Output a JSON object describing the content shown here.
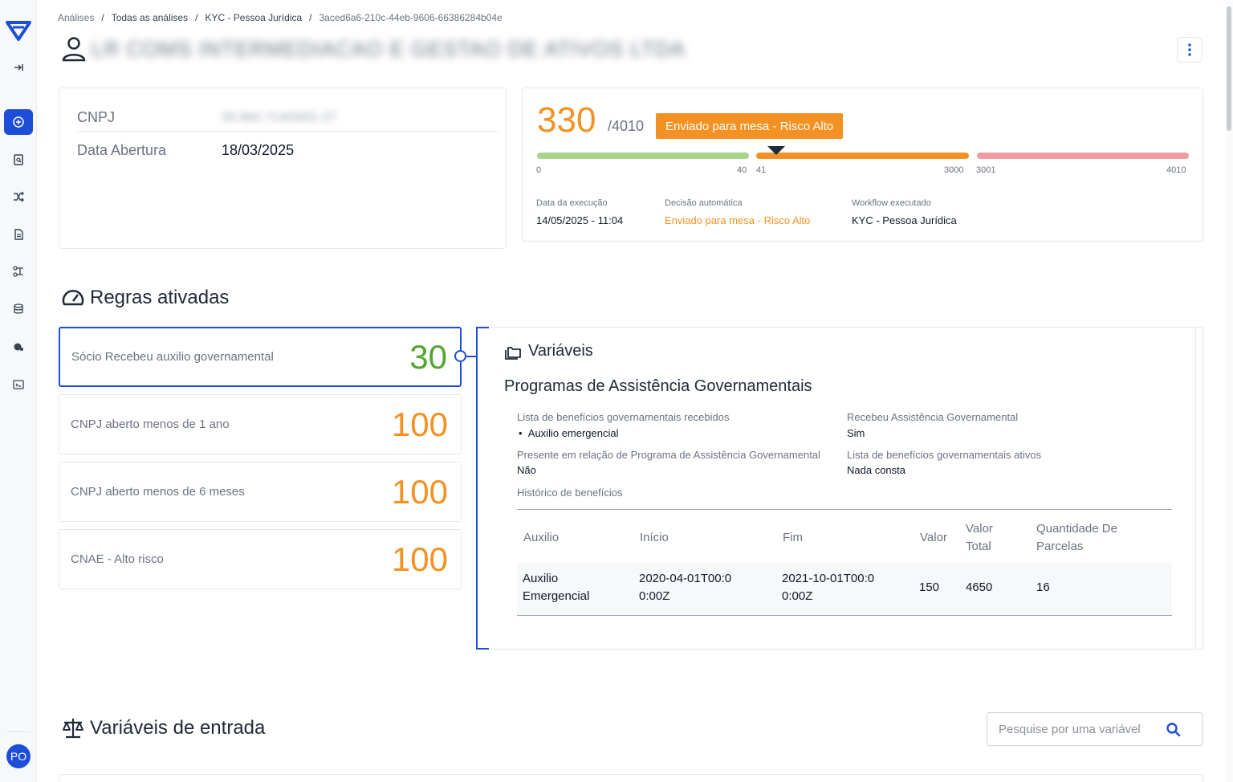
{
  "breadcrumb": [
    "Análises",
    "Todas as análises",
    "KYC - Pessoa Jurídica",
    "3aced6a6-210c-44eb-9606-66386284b04e"
  ],
  "header": {
    "company_name": "LR COMS INTERMEDIACAO E GESTAO DE ATIVOS LTDA"
  },
  "sidebar": {
    "icons": [
      "logo-icon",
      "expand-icon",
      "add-circle-icon",
      "search-document-icon",
      "shuffle-icon",
      "document-icon",
      "flow-icon",
      "database-icon",
      "analytics-icon",
      "terminal-icon"
    ],
    "avatar_initials": "PO"
  },
  "info": {
    "cnpj_label": "CNPJ",
    "cnpj_value": "59.964.714/0001-27",
    "data_abertura_label": "Data Abertura",
    "data_abertura_value": "18/03/2025"
  },
  "score": {
    "value": "330",
    "max": "/4010",
    "badge": "Enviado para mesa - Risco Alto",
    "ticks": [
      "0",
      "40",
      "41",
      "3000",
      "3001",
      "4010"
    ],
    "exec_date_label": "Data da execução",
    "exec_date_value": "14/05/2025 - 11:04",
    "decision_label": "Decisão automática",
    "decision_value": "Enviado para mesa - Risco Alto",
    "workflow_label": "Workflow executado",
    "workflow_value": "KYC - Pessoa Jurídica"
  },
  "rules": {
    "title": "Regras ativadas",
    "items": [
      {
        "name": "Sócio Recebeu auxilio governamental",
        "score": "30"
      },
      {
        "name": "CNPJ aberto menos de 1 ano",
        "score": "100"
      },
      {
        "name": "CNPJ aberto menos de 6 meses",
        "score": "100"
      },
      {
        "name": "CNAE - Alto risco",
        "score": "100"
      }
    ]
  },
  "variables": {
    "title": "Variáveis",
    "subtitle": "Programas de Assistência Governamentais",
    "f1_label": "Lista de benefícios governamentais recebidos",
    "f1_value": "Auxilio emergencial",
    "f2_label": "Recebeu Assistência Governamental",
    "f2_value": "Sim",
    "f3_label": "Presente em relação de Programa de Assistência Governamental",
    "f3_value": "Não",
    "f4_label": "Lista de benefícios governamentais ativos",
    "f4_value": "Nada consta",
    "history_label": "Histórico de benefícios",
    "table": {
      "headers": [
        "Auxilio",
        "Início",
        "Fim",
        "Valor",
        "Valor Total",
        "Quantidade De Parcelas"
      ],
      "rows": [
        [
          "Auxilio Emergencial",
          "2020-04-01T00:00:00Z",
          "2021-10-01T00:00:00Z",
          "150",
          "4650",
          "16"
        ]
      ]
    }
  },
  "inputs": {
    "title": "Variáveis de entrada",
    "search_placeholder": "Pesquise por uma variável"
  },
  "colors": {
    "brand": "#1d4ed8",
    "warning": "#f39222",
    "success": "#55a630",
    "danger_soft": "#ee9ca0",
    "success_soft": "#a9d58a"
  }
}
